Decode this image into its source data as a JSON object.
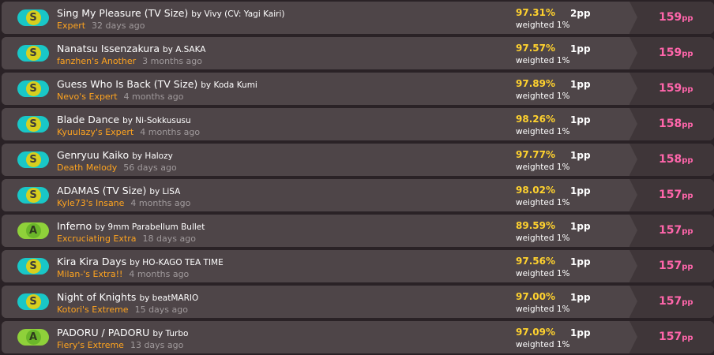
{
  "scores": [
    {
      "grade": "S",
      "title": "Sing My Pleasure (TV Size)",
      "by": "by Vivy (CV: Yagi Kairi)",
      "difficulty": "Expert",
      "ago": "32 days ago",
      "accuracy": "97.31%",
      "weighted": "weighted 1%",
      "weighted_pp": "2pp",
      "pp": "159",
      "pp_unit": "pp"
    },
    {
      "grade": "S",
      "title": "Nanatsu Issenzakura",
      "by": "by A.SAKA",
      "difficulty": "fanzhen's Another",
      "ago": "3 months ago",
      "accuracy": "97.57%",
      "weighted": "weighted 1%",
      "weighted_pp": "1pp",
      "pp": "159",
      "pp_unit": "pp"
    },
    {
      "grade": "S",
      "title": "Guess Who Is Back (TV Size)",
      "by": "by Koda Kumi",
      "difficulty": "Nevo's Expert",
      "ago": "4 months ago",
      "accuracy": "97.89%",
      "weighted": "weighted 1%",
      "weighted_pp": "1pp",
      "pp": "159",
      "pp_unit": "pp"
    },
    {
      "grade": "S",
      "title": "Blade Dance",
      "by": "by Ni-Sokkususu",
      "difficulty": "Kyuulazy's Expert",
      "ago": "4 months ago",
      "accuracy": "98.26%",
      "weighted": "weighted 1%",
      "weighted_pp": "1pp",
      "pp": "158",
      "pp_unit": "pp"
    },
    {
      "grade": "S",
      "title": "Genryuu Kaiko",
      "by": "by Halozy",
      "difficulty": "Death Melody",
      "ago": "56 days ago",
      "accuracy": "97.77%",
      "weighted": "weighted 1%",
      "weighted_pp": "1pp",
      "pp": "158",
      "pp_unit": "pp"
    },
    {
      "grade": "S",
      "title": "ADAMAS (TV Size)",
      "by": "by LiSA",
      "difficulty": "Kyle73's Insane",
      "ago": "4 months ago",
      "accuracy": "98.02%",
      "weighted": "weighted 1%",
      "weighted_pp": "1pp",
      "pp": "157",
      "pp_unit": "pp"
    },
    {
      "grade": "A",
      "title": "Inferno",
      "by": "by 9mm Parabellum Bullet",
      "difficulty": "Excruciating Extra",
      "ago": "18 days ago",
      "accuracy": "89.59%",
      "weighted": "weighted 1%",
      "weighted_pp": "1pp",
      "pp": "157",
      "pp_unit": "pp"
    },
    {
      "grade": "S",
      "title": "Kira Kira Days",
      "by": "by HO-KAGO TEA TIME",
      "difficulty": "Milan-'s Extra!!",
      "ago": "4 months ago",
      "accuracy": "97.56%",
      "weighted": "weighted 1%",
      "weighted_pp": "1pp",
      "pp": "157",
      "pp_unit": "pp"
    },
    {
      "grade": "S",
      "title": "Night of Knights",
      "by": "by beatMARIO",
      "difficulty": "Kotori's Extreme",
      "ago": "15 days ago",
      "accuracy": "97.00%",
      "weighted": "weighted 1%",
      "weighted_pp": "1pp",
      "pp": "157",
      "pp_unit": "pp"
    },
    {
      "grade": "A",
      "title": "PADORU / PADORU",
      "by": "by Turbo",
      "difficulty": "Fiery's Extreme",
      "ago": "13 days ago",
      "accuracy": "97.09%",
      "weighted": "weighted 1%",
      "weighted_pp": "1pp",
      "pp": "157",
      "pp_unit": "pp"
    }
  ],
  "colors": {
    "row_bg": "#4e4548",
    "pp_bg": "#3f3639",
    "difficulty": "#ffa41f",
    "accuracy": "#ffd22e",
    "pp": "#ff66ab",
    "grade_s": "#19c7c7",
    "grade_a": "#8fd13a"
  }
}
